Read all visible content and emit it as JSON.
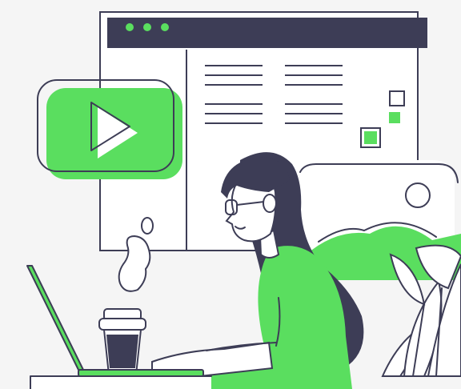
{
  "illustration": {
    "subject": "woman-working-on-laptop-with-video-content",
    "colors": {
      "accent": "#5ade5f",
      "outline": "#3d3d56",
      "background": "#f5f5f5",
      "paper": "#ffffff"
    },
    "icons": {
      "play": "play-icon",
      "window_dots": 3
    }
  }
}
